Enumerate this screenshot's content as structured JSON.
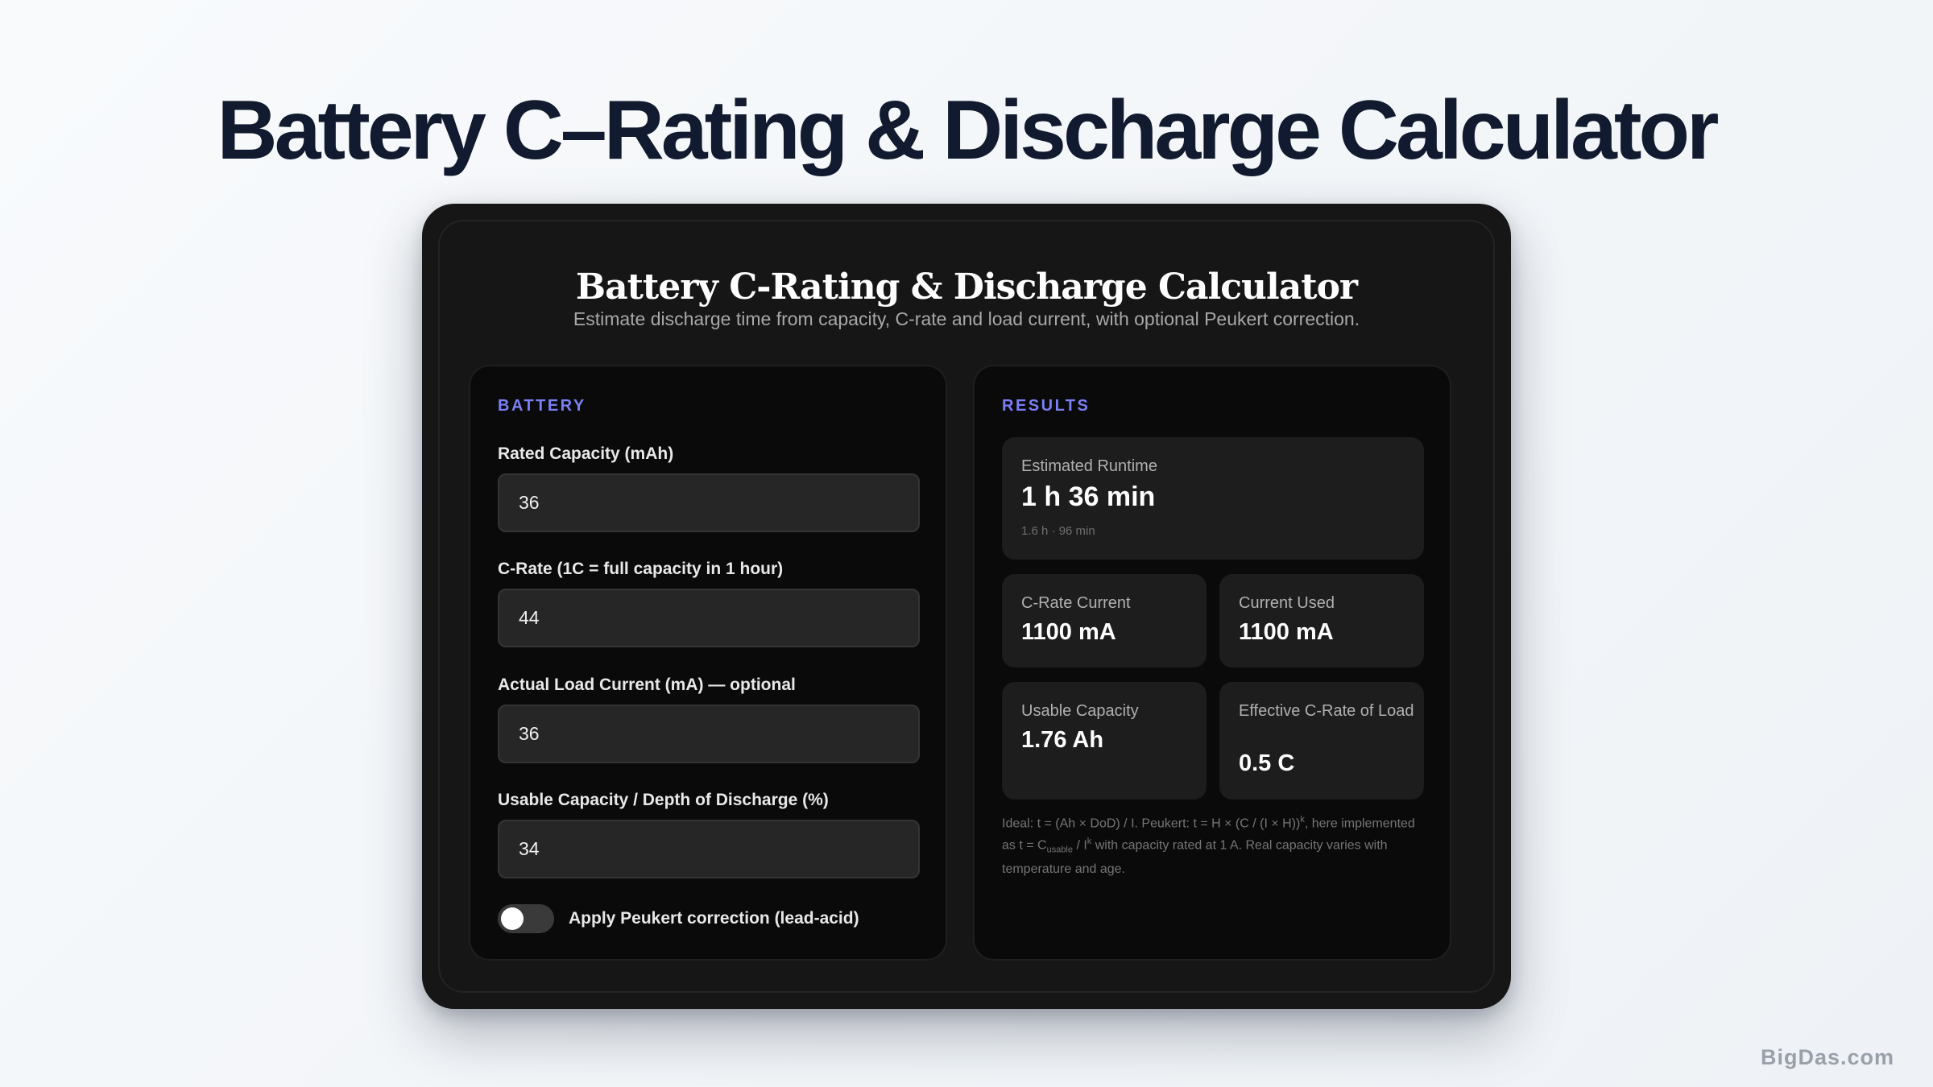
{
  "page": {
    "heading": "Battery C–Rating & Discharge Calculator",
    "watermark": "BigDas.com"
  },
  "card": {
    "title": "Battery C-Rating & Discharge Calculator",
    "subtitle": "Estimate discharge time from capacity, C-rate and load current, with optional Peukert correction."
  },
  "battery": {
    "section_label": "BATTERY",
    "fields": [
      {
        "label": "Rated Capacity (mAh)",
        "value": "36"
      },
      {
        "label": "C-Rate (1C = full capacity in 1 hour)",
        "value": "44"
      },
      {
        "label": "Actual Load Current (mA) — optional",
        "value": "36"
      },
      {
        "label": "Usable Capacity / Depth of Discharge (%)",
        "value": "34"
      }
    ],
    "peukert_toggle": {
      "label": "Apply Peukert correction (lead-acid)",
      "checked": false
    }
  },
  "results": {
    "section_label": "RESULTS",
    "runtime": {
      "label": "Estimated Runtime",
      "value": "1 h 36 min",
      "sub": "1.6 h · 96 min"
    },
    "c_rate_current": {
      "label": "C-Rate Current",
      "value": "1100 mA"
    },
    "current_used": {
      "label": "Current Used",
      "value": "1100 mA"
    },
    "usable_capacity": {
      "label": "Usable Capacity",
      "value": "1.76 Ah"
    },
    "effective_c_rate": {
      "label": "Effective C-Rate of Load",
      "value": "0.5 C"
    },
    "footnote": {
      "part1": "Ideal: t = (Ah × DoD) / I. Peukert: t = H × (C / (I × H))",
      "sup1": "k",
      "part2": ", here implemented as t = C",
      "sub1": "usable",
      "part3": " / I",
      "sup2": "k",
      "part4": " with capacity rated at 1 A. Real capacity varies with temperature and age."
    }
  },
  "colors": {
    "accent": "#7b7ff5",
    "heading": "#111a2e",
    "card_background": "#161616",
    "panel_background": "#0a0a0a",
    "input_background": "#262626"
  }
}
